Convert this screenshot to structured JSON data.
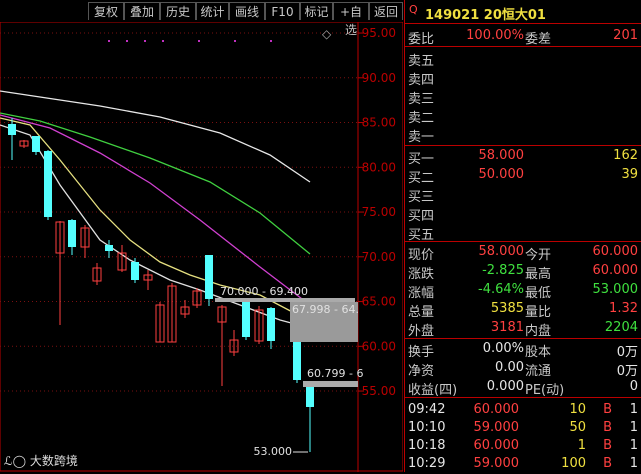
{
  "toolbar": {
    "buttons": [
      "复权",
      "叠加",
      "历史",
      "统计",
      "画线",
      "F10",
      "标记",
      "+自选",
      "返回"
    ],
    "diamond": "◇"
  },
  "chart_data": {
    "type": "candlestick",
    "y_axis_labels": [
      "95.00",
      "90.00",
      "85.00",
      "80.00",
      "75.00",
      "70.00",
      "65.00",
      "60.00",
      "55.00"
    ],
    "y_values": [
      95,
      90,
      85,
      80,
      75,
      70,
      65,
      60,
      55
    ],
    "annotations": {
      "range1": "70.000 - 69.400",
      "range2": "67.998 - 64.",
      "range3": "60.799 - 6",
      "low": "53.000"
    }
  },
  "quote": {
    "code_name": "149021 20恒大01",
    "weibi_label": "委比",
    "weibi_value": "100.00%",
    "weicha_label": "委差",
    "weicha_value": "201",
    "sell_labels": [
      "卖五",
      "卖四",
      "卖三",
      "卖二",
      "卖一"
    ],
    "buy": [
      {
        "label": "买一",
        "price": "58.000",
        "vol": "162"
      },
      {
        "label": "买二",
        "price": "50.000",
        "vol": "39"
      },
      {
        "label": "买三",
        "price": "",
        "vol": ""
      },
      {
        "label": "买四",
        "price": "",
        "vol": ""
      },
      {
        "label": "买五",
        "price": "",
        "vol": ""
      }
    ],
    "stats": [
      {
        "l1": "现价",
        "v1": "58.000",
        "c1": "red",
        "l2": "今开",
        "v2": "60.000",
        "c2": "red"
      },
      {
        "l1": "涨跌",
        "v1": "-2.825",
        "c1": "green",
        "l2": "最高",
        "v2": "60.000",
        "c2": "red"
      },
      {
        "l1": "涨幅",
        "v1": "-4.64%",
        "c1": "green",
        "l2": "最低",
        "v2": "53.000",
        "c2": "green"
      },
      {
        "l1": "总量",
        "v1": "5385",
        "c1": "yellow",
        "l2": "量比",
        "v2": "1.32",
        "c2": "red"
      },
      {
        "l1": "外盘",
        "v1": "3181",
        "c1": "red",
        "l2": "内盘",
        "v2": "2204",
        "c2": "green"
      }
    ],
    "stats2": [
      {
        "l1": "换手",
        "v1": "0.00%",
        "l2": "股本",
        "v2": "0万"
      },
      {
        "l1": "净资",
        "v1": "0.00",
        "l2": "流通",
        "v2": "0万"
      },
      {
        "l1": "收益(四)",
        "v1": "0.000",
        "l2": "PE(动)",
        "v2": "0"
      }
    ],
    "ticks": [
      {
        "time": "09:42",
        "price": "60.000",
        "vol": "10",
        "side": "B",
        "n": "1"
      },
      {
        "time": "10:10",
        "price": "59.000",
        "vol": "50",
        "side": "B",
        "n": "1"
      },
      {
        "time": "10:18",
        "price": "60.000",
        "vol": "1",
        "side": "B",
        "n": "1"
      },
      {
        "time": "10:29",
        "price": "59.000",
        "vol": "100",
        "side": "B",
        "n": "1"
      }
    ]
  },
  "watermark": "大数跨境"
}
